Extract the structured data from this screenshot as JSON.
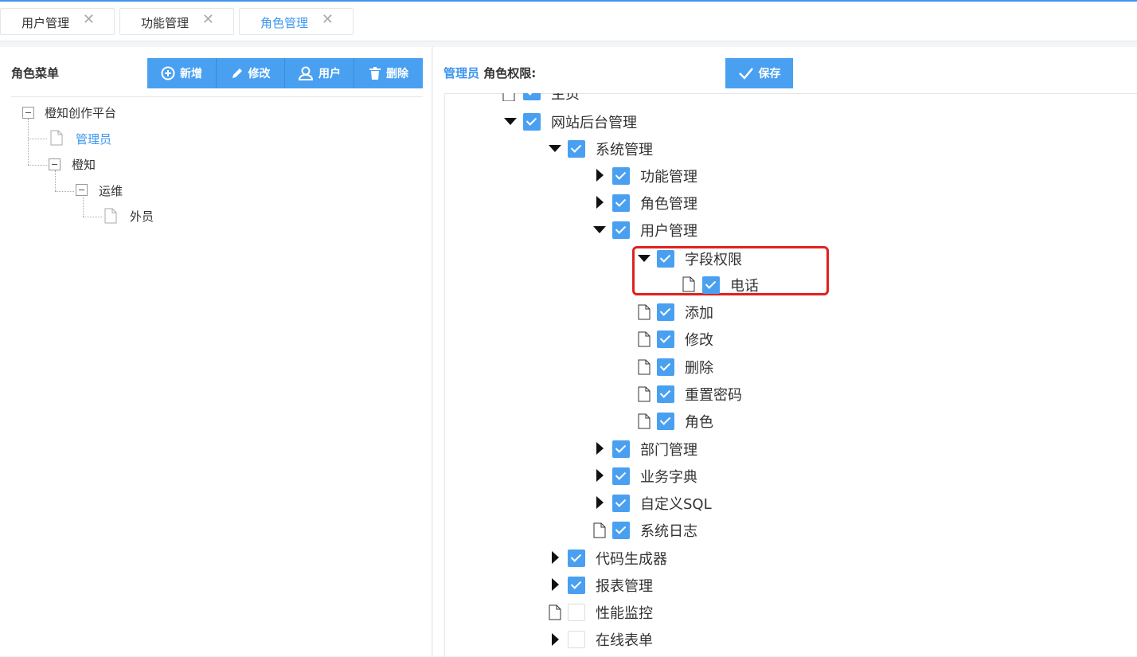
{
  "tabs": [
    {
      "label": "用户管理",
      "active": false
    },
    {
      "label": "功能管理",
      "active": false
    },
    {
      "label": "角色管理",
      "active": true
    }
  ],
  "left_panel": {
    "title": "角色菜单",
    "buttons": {
      "add": "新增",
      "edit": "修改",
      "user": "用户",
      "delete": "删除"
    },
    "tree": {
      "root": "橙知创作平台",
      "admin": "管理员",
      "chengzhi": "橙知",
      "ops": "运维",
      "external": "外员"
    }
  },
  "right_panel": {
    "role_name": "管理员",
    "perm_label": "角色权限:",
    "save_label": "保存",
    "nodes": {
      "n0": "主页",
      "n1": "网站后台管理",
      "n2": "系统管理",
      "n3": "功能管理",
      "n4": "角色管理",
      "n5": "用户管理",
      "n6": "字段权限",
      "n7": "电话",
      "n8": "添加",
      "n9": "修改",
      "n10": "删除",
      "n11": "重置密码",
      "n12": "角色",
      "n13": "部门管理",
      "n14": "业务字典",
      "n15": "自定义SQL",
      "n16": "系统日志",
      "n17": "代码生成器",
      "n18": "报表管理",
      "n19": "性能监控",
      "n20": "在线表单"
    }
  },
  "colors": {
    "accent": "#3d96ee",
    "button": "#4aa0f0",
    "highlight": "#e02020"
  }
}
